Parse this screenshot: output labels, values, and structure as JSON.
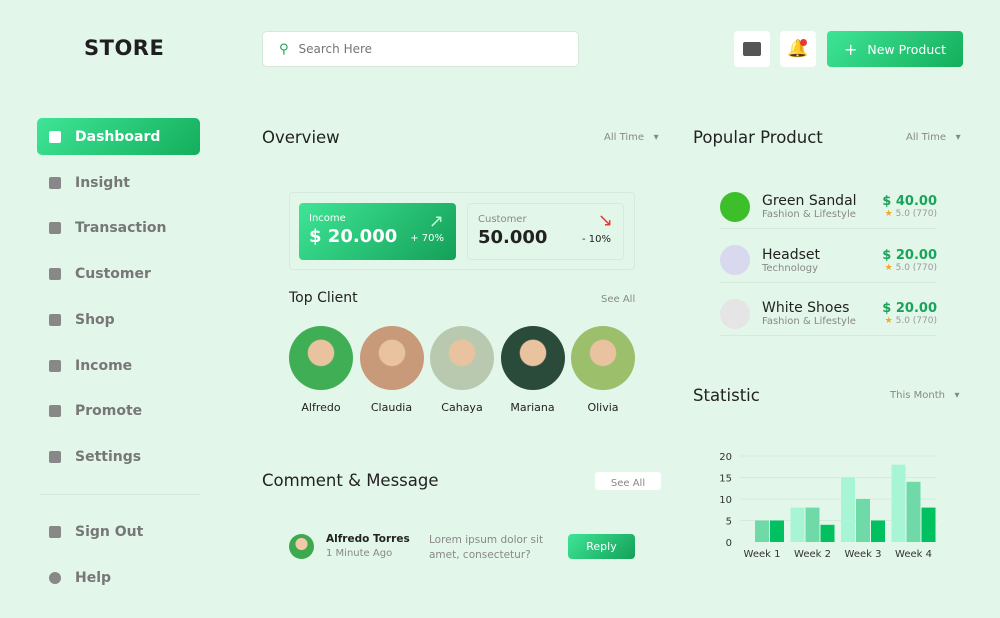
{
  "logo": "STORE",
  "search": {
    "placeholder": "Search Here"
  },
  "header": {
    "new_product": "New Product",
    "notification_badge_color": "#e53935"
  },
  "sidebar": {
    "items": [
      {
        "label": "Dashboard",
        "icon": "grid-icon",
        "active": true
      },
      {
        "label": "Insight",
        "icon": "bar-chart-icon"
      },
      {
        "label": "Transaction",
        "icon": "document-icon"
      },
      {
        "label": "Customer",
        "icon": "users-icon"
      },
      {
        "label": "Shop",
        "icon": "bag-icon"
      },
      {
        "label": "Income",
        "icon": "money-icon"
      },
      {
        "label": "Promote",
        "icon": "megaphone-icon"
      },
      {
        "label": "Settings",
        "icon": "gear-icon"
      }
    ],
    "bottom": [
      {
        "label": "Sign Out",
        "icon": "sign-out-icon"
      },
      {
        "label": "Help",
        "icon": "help-icon"
      }
    ]
  },
  "overview": {
    "title": "Overview",
    "filter": "All Time",
    "income": {
      "label": "Income",
      "value": "$ 20.000",
      "change": "+ 70%"
    },
    "customer": {
      "label": "Customer",
      "value": "50.000",
      "change": "- 10%"
    }
  },
  "top_client": {
    "title": "Top Client",
    "see_all": "See All",
    "clients": [
      "Alfredo",
      "Claudia",
      "Cahaya",
      "Mariana",
      "Olivia"
    ]
  },
  "comments": {
    "title": "Comment & Message",
    "see_all": "See All",
    "items": [
      {
        "name": "Alfredo Torres",
        "time": "1 Minute Ago",
        "text": "Lorem ipsum dolor sit amet, consectetur?",
        "reply": "Reply"
      }
    ]
  },
  "popular": {
    "title": "Popular Product",
    "filter": "All Time",
    "items": [
      {
        "name": "Green Sandal",
        "category": "Fashion & Lifestyle",
        "price": "$ 40.00",
        "rating": "5.0 (770)"
      },
      {
        "name": "Headset",
        "category": "Technology",
        "price": "$ 20.00",
        "rating": "5.0 (770)"
      },
      {
        "name": "White Shoes",
        "category": "Fashion & Lifestyle",
        "price": "$ 20.00",
        "rating": "5.0 (770)"
      }
    ]
  },
  "statistic": {
    "title": "Statistic",
    "filter": "This Month"
  },
  "chart_data": {
    "type": "bar",
    "categories": [
      "Week 1",
      "Week 2",
      "Week 3",
      "Week 4"
    ],
    "series": [
      {
        "values": [
          0,
          8,
          15,
          18
        ],
        "color": "#a8f5d6"
      },
      {
        "values": [
          5,
          8,
          10,
          14
        ],
        "color": "#6fd9a7"
      },
      {
        "values": [
          5,
          4,
          5,
          8
        ],
        "color": "#00c060"
      }
    ],
    "yticks": [
      0,
      5,
      10,
      15,
      20
    ],
    "ylim": [
      0,
      20
    ],
    "grid": true
  }
}
